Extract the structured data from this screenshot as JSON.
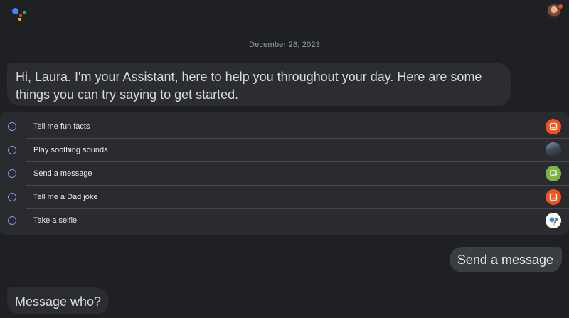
{
  "conversation": {
    "date": "December 28, 2023",
    "greeting": "Hi, Laura. I'm your Assistant, here to help you throughout your day. Here are some things you can try saying to get started.",
    "suggestions": [
      {
        "label": "Tell me fun facts",
        "icon": "sticky-note-icon",
        "icon_color": "#f4511e"
      },
      {
        "label": "Play soothing sounds",
        "icon": "landscape-thumbnail-icon",
        "icon_color": "#5f7486"
      },
      {
        "label": "Send a message",
        "icon": "message-icon",
        "icon_color": "#7cb342"
      },
      {
        "label": "Tell me a Dad joke",
        "icon": "sticky-note-icon",
        "icon_color": "#f4511e"
      },
      {
        "label": "Take a selfie",
        "icon": "assistant-logo-icon",
        "icon_color": "#ffffff"
      }
    ],
    "user_message": "Send a message",
    "assistant_followup": "Message who?"
  },
  "colors": {
    "background": "#1f2023",
    "bubble": "#2b2d31",
    "user_bubble": "#3a3d42",
    "radio_accent": "#7c9fe6",
    "logo_blue": "#4285f4",
    "logo_red": "#ea4335",
    "logo_yellow": "#fbbc05",
    "logo_green": "#34a853"
  }
}
